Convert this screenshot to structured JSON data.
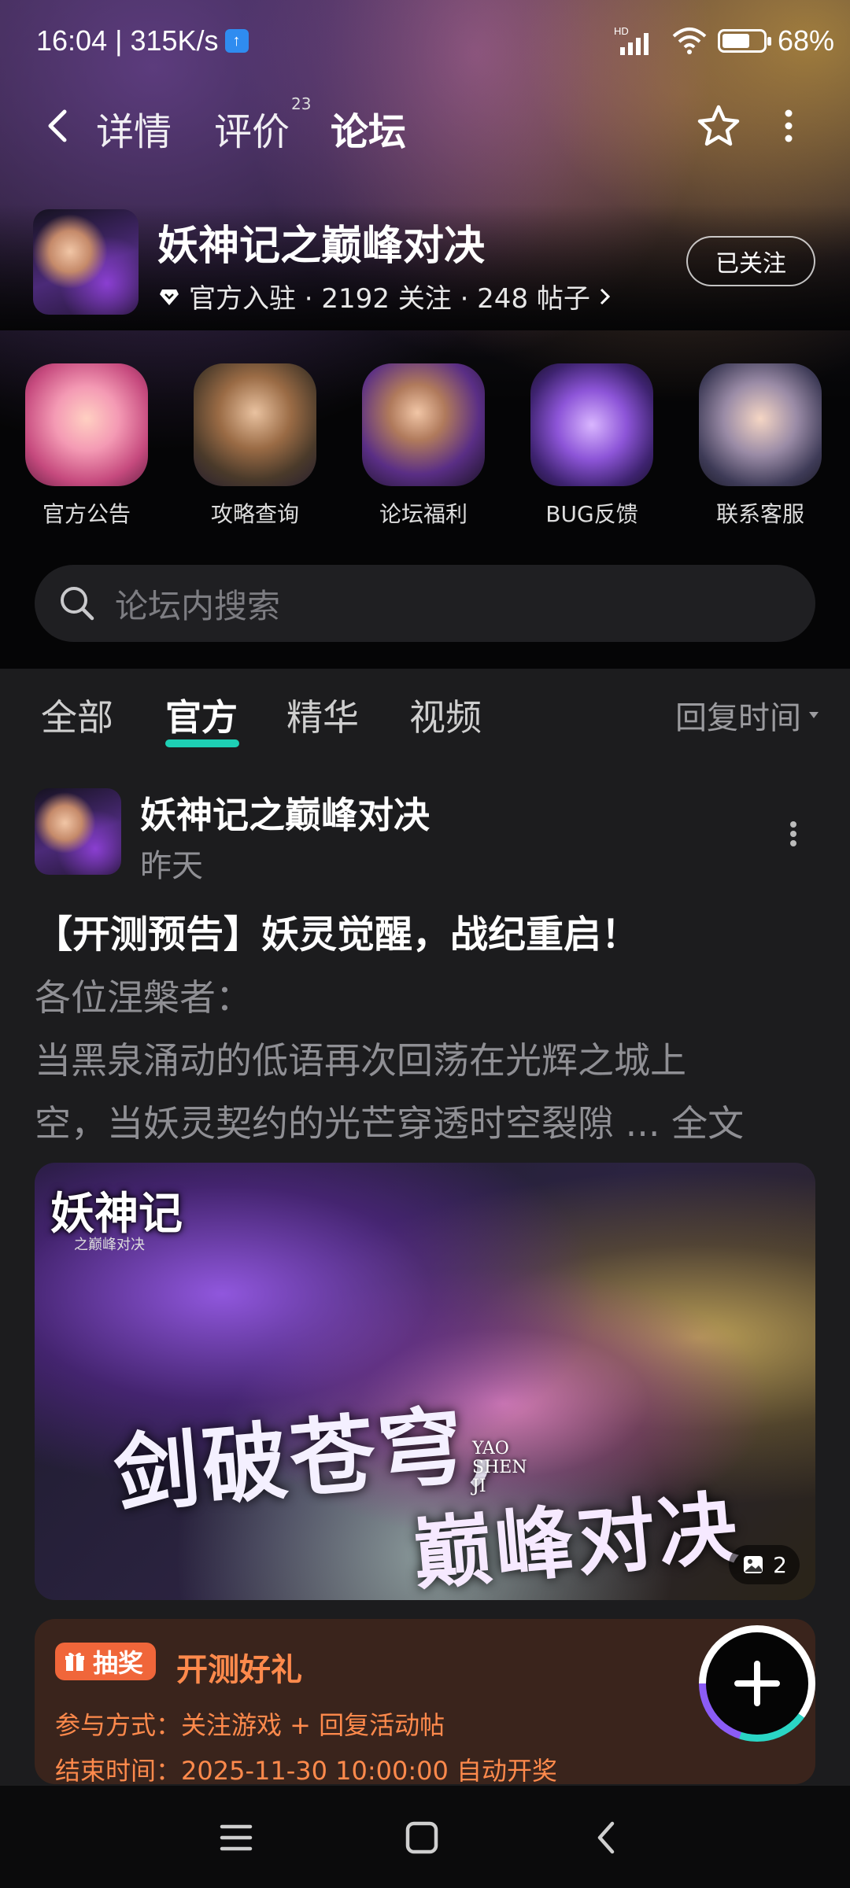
{
  "status_bar": {
    "time_speed": "16:04 | 315K/s",
    "upload_badge": "↑",
    "network_label": "HD",
    "battery_percent": "68%",
    "battery_level": 0.68
  },
  "nav": {
    "details": "详情",
    "reviews": "评价",
    "reviews_count": "23",
    "forum": "论坛"
  },
  "game": {
    "title": "妖神记之巅峰对决",
    "meta": "官方入驻 · 2192 关注 · 248 帖子",
    "follow_button": "已关注"
  },
  "quick_entries": [
    {
      "label": "官方公告"
    },
    {
      "label": "攻略查询"
    },
    {
      "label": "论坛福利"
    },
    {
      "label": "BUG反馈"
    },
    {
      "label": "联系客服"
    }
  ],
  "search": {
    "placeholder": "论坛内搜索"
  },
  "filter_tabs": {
    "all": "全部",
    "official": "官方",
    "featured": "精华",
    "video": "视频",
    "sort": "回复时间"
  },
  "post": {
    "author": "妖神记之巅峰对决",
    "time": "昨天",
    "title": "【开测预告】妖灵觉醒，战纪重启！",
    "line1": "各位涅槃者：",
    "line2": "当黑泉涌动的低语再次回荡在光辉之城上",
    "line3": "空，当妖灵契约的光芒穿透时空裂隙 ...",
    "read_more": "全文",
    "image_count": "2",
    "banner": {
      "logo": "妖神记",
      "logo_sub": "之巅峰对决",
      "slogan1": "剑破苍穹,",
      "slogan2": "巅峰对决",
      "english": "YAO SHEN JI"
    }
  },
  "lottery": {
    "badge": "抽奖",
    "title": "开测好礼",
    "join": "参与方式：关注游戏 + 回复活动帖",
    "end": "结束时间：2025-11-30 10:00:00 自动开奖"
  },
  "colors": {
    "accent": "#1ecfb4",
    "lottery_text": "#ff8a4c",
    "lottery_bg": "#3a241c",
    "background": "#1c1c1e"
  }
}
